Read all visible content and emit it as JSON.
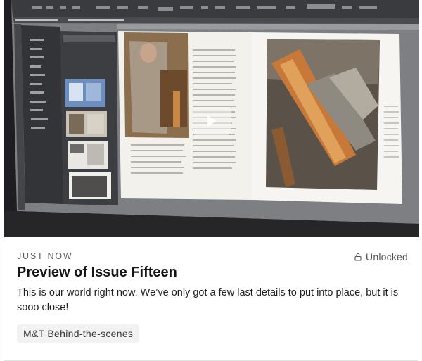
{
  "post": {
    "meta": "JUST NOW",
    "status": "Unlocked",
    "status_icon": "lock-open-icon",
    "title": "Preview of Issue Fifteen",
    "description": "This is our world right now. We’ve only got a few last details to put into place, but it is sooo close!",
    "tag": "M&T Behind-the-scenes"
  },
  "video": {
    "play_icon": "play-icon"
  },
  "colors": {
    "media_bg": "#1c1c1f",
    "tag_bg": "#f2f2f2",
    "text_muted": "#5f5f5f"
  }
}
